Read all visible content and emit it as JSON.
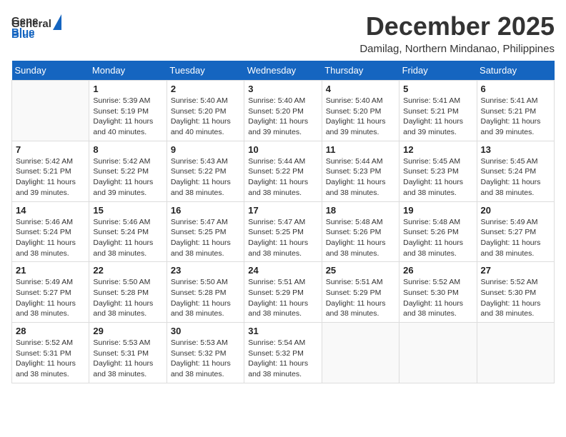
{
  "logo": {
    "line1": "General",
    "line2": "Blue"
  },
  "header": {
    "month": "December 2025",
    "location": "Damilag, Northern Mindanao, Philippines"
  },
  "weekdays": [
    "Sunday",
    "Monday",
    "Tuesday",
    "Wednesday",
    "Thursday",
    "Friday",
    "Saturday"
  ],
  "weeks": [
    [
      {
        "day": "",
        "info": ""
      },
      {
        "day": "1",
        "info": "Sunrise: 5:39 AM\nSunset: 5:19 PM\nDaylight: 11 hours\nand 40 minutes."
      },
      {
        "day": "2",
        "info": "Sunrise: 5:40 AM\nSunset: 5:20 PM\nDaylight: 11 hours\nand 40 minutes."
      },
      {
        "day": "3",
        "info": "Sunrise: 5:40 AM\nSunset: 5:20 PM\nDaylight: 11 hours\nand 39 minutes."
      },
      {
        "day": "4",
        "info": "Sunrise: 5:40 AM\nSunset: 5:20 PM\nDaylight: 11 hours\nand 39 minutes."
      },
      {
        "day": "5",
        "info": "Sunrise: 5:41 AM\nSunset: 5:21 PM\nDaylight: 11 hours\nand 39 minutes."
      },
      {
        "day": "6",
        "info": "Sunrise: 5:41 AM\nSunset: 5:21 PM\nDaylight: 11 hours\nand 39 minutes."
      }
    ],
    [
      {
        "day": "7",
        "info": "Sunrise: 5:42 AM\nSunset: 5:21 PM\nDaylight: 11 hours\nand 39 minutes."
      },
      {
        "day": "8",
        "info": "Sunrise: 5:42 AM\nSunset: 5:22 PM\nDaylight: 11 hours\nand 39 minutes."
      },
      {
        "day": "9",
        "info": "Sunrise: 5:43 AM\nSunset: 5:22 PM\nDaylight: 11 hours\nand 38 minutes."
      },
      {
        "day": "10",
        "info": "Sunrise: 5:44 AM\nSunset: 5:22 PM\nDaylight: 11 hours\nand 38 minutes."
      },
      {
        "day": "11",
        "info": "Sunrise: 5:44 AM\nSunset: 5:23 PM\nDaylight: 11 hours\nand 38 minutes."
      },
      {
        "day": "12",
        "info": "Sunrise: 5:45 AM\nSunset: 5:23 PM\nDaylight: 11 hours\nand 38 minutes."
      },
      {
        "day": "13",
        "info": "Sunrise: 5:45 AM\nSunset: 5:24 PM\nDaylight: 11 hours\nand 38 minutes."
      }
    ],
    [
      {
        "day": "14",
        "info": "Sunrise: 5:46 AM\nSunset: 5:24 PM\nDaylight: 11 hours\nand 38 minutes."
      },
      {
        "day": "15",
        "info": "Sunrise: 5:46 AM\nSunset: 5:24 PM\nDaylight: 11 hours\nand 38 minutes."
      },
      {
        "day": "16",
        "info": "Sunrise: 5:47 AM\nSunset: 5:25 PM\nDaylight: 11 hours\nand 38 minutes."
      },
      {
        "day": "17",
        "info": "Sunrise: 5:47 AM\nSunset: 5:25 PM\nDaylight: 11 hours\nand 38 minutes."
      },
      {
        "day": "18",
        "info": "Sunrise: 5:48 AM\nSunset: 5:26 PM\nDaylight: 11 hours\nand 38 minutes."
      },
      {
        "day": "19",
        "info": "Sunrise: 5:48 AM\nSunset: 5:26 PM\nDaylight: 11 hours\nand 38 minutes."
      },
      {
        "day": "20",
        "info": "Sunrise: 5:49 AM\nSunset: 5:27 PM\nDaylight: 11 hours\nand 38 minutes."
      }
    ],
    [
      {
        "day": "21",
        "info": "Sunrise: 5:49 AM\nSunset: 5:27 PM\nDaylight: 11 hours\nand 38 minutes."
      },
      {
        "day": "22",
        "info": "Sunrise: 5:50 AM\nSunset: 5:28 PM\nDaylight: 11 hours\nand 38 minutes."
      },
      {
        "day": "23",
        "info": "Sunrise: 5:50 AM\nSunset: 5:28 PM\nDaylight: 11 hours\nand 38 minutes."
      },
      {
        "day": "24",
        "info": "Sunrise: 5:51 AM\nSunset: 5:29 PM\nDaylight: 11 hours\nand 38 minutes."
      },
      {
        "day": "25",
        "info": "Sunrise: 5:51 AM\nSunset: 5:29 PM\nDaylight: 11 hours\nand 38 minutes."
      },
      {
        "day": "26",
        "info": "Sunrise: 5:52 AM\nSunset: 5:30 PM\nDaylight: 11 hours\nand 38 minutes."
      },
      {
        "day": "27",
        "info": "Sunrise: 5:52 AM\nSunset: 5:30 PM\nDaylight: 11 hours\nand 38 minutes."
      }
    ],
    [
      {
        "day": "28",
        "info": "Sunrise: 5:52 AM\nSunset: 5:31 PM\nDaylight: 11 hours\nand 38 minutes."
      },
      {
        "day": "29",
        "info": "Sunrise: 5:53 AM\nSunset: 5:31 PM\nDaylight: 11 hours\nand 38 minutes."
      },
      {
        "day": "30",
        "info": "Sunrise: 5:53 AM\nSunset: 5:32 PM\nDaylight: 11 hours\nand 38 minutes."
      },
      {
        "day": "31",
        "info": "Sunrise: 5:54 AM\nSunset: 5:32 PM\nDaylight: 11 hours\nand 38 minutes."
      },
      {
        "day": "",
        "info": ""
      },
      {
        "day": "",
        "info": ""
      },
      {
        "day": "",
        "info": ""
      }
    ]
  ]
}
